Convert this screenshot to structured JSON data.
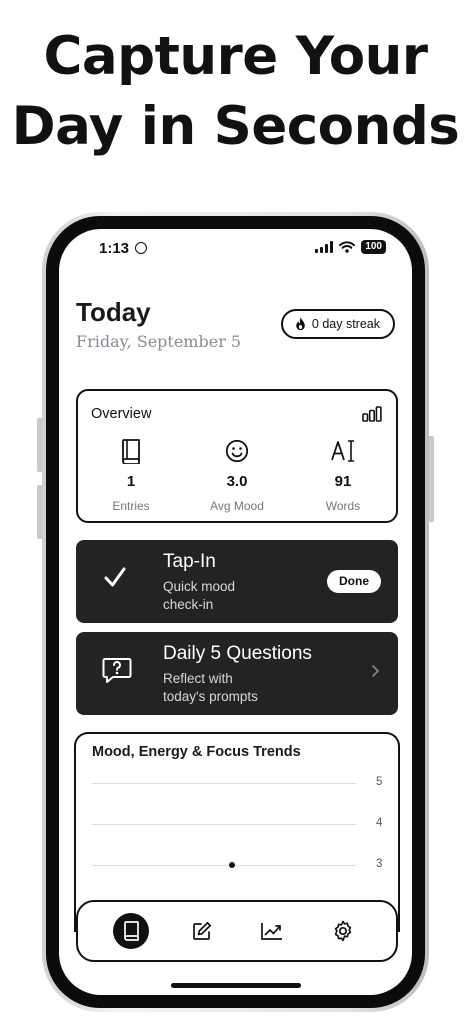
{
  "headline": {
    "line1": "Capture Your",
    "line2": "Day in Seconds"
  },
  "status_bar": {
    "time": "1:13",
    "battery": "100"
  },
  "header": {
    "title": "Today",
    "date": "Friday, September 5",
    "streak": "0 day streak"
  },
  "overview": {
    "title": "Overview",
    "stats": [
      {
        "value": "1",
        "label": "Entries",
        "icon": "book-icon"
      },
      {
        "value": "3.0",
        "label": "Avg Mood",
        "icon": "smiley-icon"
      },
      {
        "value": "91",
        "label": "Words",
        "icon": "text-cursor-icon"
      }
    ]
  },
  "tap_in": {
    "title": "Tap-In",
    "subtitle": "Quick mood check-in",
    "button": "Done",
    "icon": "checkmark-icon"
  },
  "daily_questions": {
    "title": "Daily 5 Questions",
    "subtitle": "Reflect with today's prompts",
    "icon": "question-bubble-icon"
  },
  "trends": {
    "title": "Mood, Energy & Focus Trends",
    "y_ticks": [
      "5",
      "4",
      "3"
    ]
  },
  "chart_data": {
    "type": "scatter",
    "title": "Mood, Energy & Focus Trends",
    "ylim": [
      3,
      5
    ],
    "y_ticks": [
      5,
      4,
      3
    ],
    "points": [
      {
        "y": 3.0
      }
    ]
  },
  "nav": {
    "items": [
      {
        "icon": "journal-icon",
        "active": true
      },
      {
        "icon": "compose-icon",
        "active": false
      },
      {
        "icon": "trend-chart-icon",
        "active": false
      },
      {
        "icon": "gear-icon",
        "active": false
      }
    ]
  },
  "colors": {
    "accent": "#111111",
    "card_dark": "#232323",
    "muted_text": "#8a8a96"
  }
}
